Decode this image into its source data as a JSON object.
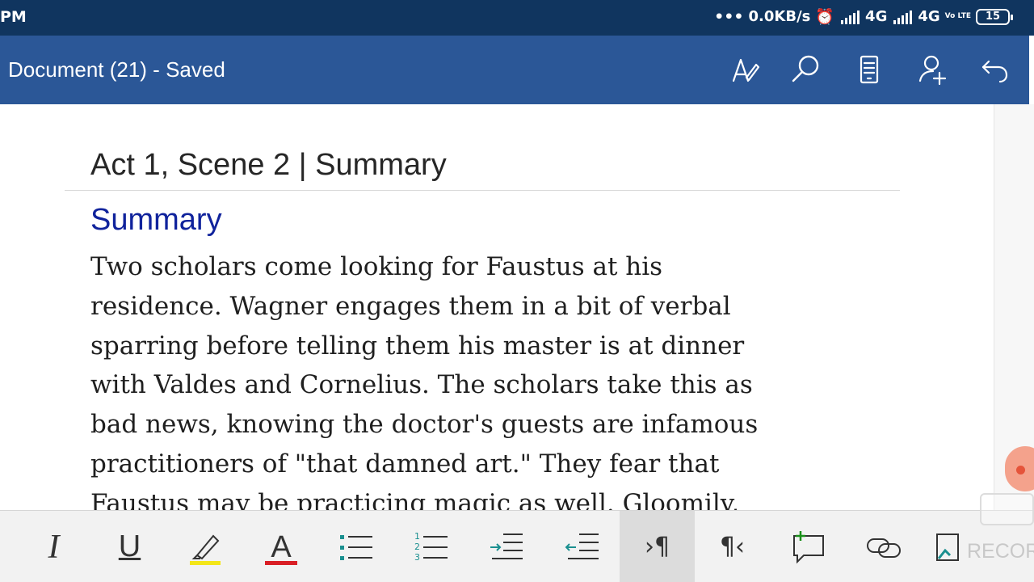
{
  "status_bar": {
    "time": "PM",
    "speed": "0.0KB/s",
    "network1": "4G",
    "network2": "4G",
    "volte": "Vo LTE",
    "battery": "15"
  },
  "title_bar": {
    "title": "Document (21) - Saved",
    "icons": [
      "draw-pen-icon",
      "search-icon",
      "reading-view-icon",
      "share-person-icon",
      "undo-icon"
    ]
  },
  "document": {
    "heading": "Act 1, Scene 2 | Summary",
    "subheading": "Summary",
    "lines": [
      "Two scholars come looking for Faustus at his",
      "residence. Wagner engages them in a bit of verbal",
      "sparring before telling them his master is at dinner",
      "with Valdes and Cornelius. The scholars take this as",
      "bad news, knowing the doctor's guests are infamous",
      "practitioners of \"that damned art.\" They fear that",
      "Faustus may be practicing magic as well. Gloomily,"
    ]
  },
  "toolbar": {
    "italic": "I",
    "underline": "U",
    "font_color": "A",
    "highlight_color": "#f3e619",
    "font_color_bar": "#d91f26",
    "ltr": "›¶",
    "rtl": "¶‹",
    "selected_tool": "ltr-direction"
  },
  "watermark": {
    "text": "RECOR"
  }
}
